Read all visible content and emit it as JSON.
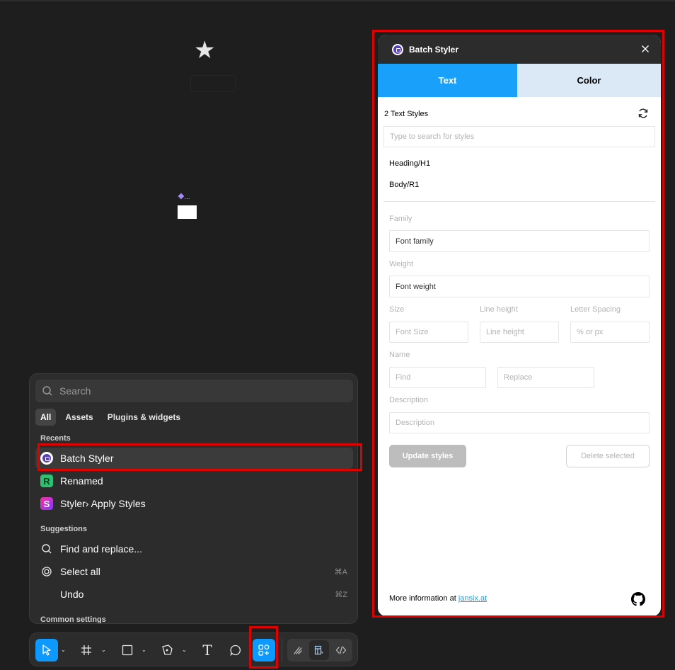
{
  "canvas": {
    "star_glyph": "★",
    "component_glyph": "❖",
    "component_ellipsis": "..."
  },
  "quick_actions": {
    "search_placeholder": "Search",
    "tabs": [
      "All",
      "Assets",
      "Plugins & widgets"
    ],
    "recents_label": "Recents",
    "recents": [
      {
        "label": "Batch Styler",
        "icon": "batch-styler-icon"
      },
      {
        "label": "Renamed",
        "icon": "renamed-icon",
        "glyph": "R"
      },
      {
        "label": "Styler› Apply Styles",
        "icon": "styler-icon",
        "glyph": "S"
      }
    ],
    "suggestions_label": "Suggestions",
    "suggestions": [
      {
        "label": "Find and replace...",
        "icon": "search-icon",
        "shortcut": ""
      },
      {
        "label": "Select all",
        "icon": "select-all-icon",
        "shortcut": "⌘A"
      },
      {
        "label": "Undo",
        "icon": "",
        "shortcut": "⌘Z"
      }
    ],
    "common_label": "Common settings"
  },
  "toolbar": {
    "tools": [
      "move-tool",
      "frame-tool",
      "shape-tool",
      "pen-tool",
      "text-tool",
      "comment-tool",
      "actions-tool"
    ],
    "active_color": "#0d99ff",
    "text_glyph": "T"
  },
  "plugin": {
    "title": "Batch Styler",
    "tabs": {
      "text": "Text",
      "color": "Color"
    },
    "style_count": "2 Text Styles",
    "search_placeholder": "Type to search for styles",
    "styles": [
      "Heading/H1",
      "Body/R1"
    ],
    "fields": {
      "family_label": "Family",
      "family_value": "Font family",
      "weight_label": "Weight",
      "weight_value": "Font weight",
      "size_label": "Size",
      "size_placeholder": "Font Size",
      "line_height_label": "Line height",
      "line_height_placeholder": "Line height",
      "letter_spacing_label": "Letter Spacing",
      "letter_spacing_placeholder": "% or px",
      "name_label": "Name",
      "find_placeholder": "Find",
      "replace_placeholder": "Replace",
      "description_label": "Description",
      "description_placeholder": "Description"
    },
    "update_button": "Update styles",
    "delete_button": "Delete selected",
    "footer_text": "More information at ",
    "footer_link": "jansix.at",
    "accent": "#18a0fb"
  }
}
